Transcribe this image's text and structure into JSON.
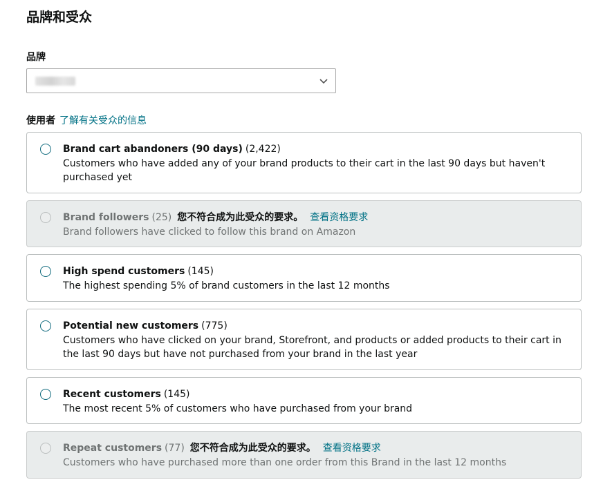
{
  "page": {
    "section_title": "品牌和受众",
    "brand_label": "品牌",
    "usage_label": "使用者",
    "usage_link": "了解有关受众的信息"
  },
  "audiences": [
    {
      "name": "Brand cart abandoners (90 days)",
      "count": "(2,422)",
      "description": "Customers who have added any of your brand products to their cart in the last 90 days but haven't purchased yet",
      "disabled": false
    },
    {
      "name": "Brand followers",
      "count": "(25)",
      "warning": "您不符合成为此受众的要求。",
      "requirements_link": "查看资格要求",
      "description": "Brand followers have clicked to follow this brand on Amazon",
      "disabled": true
    },
    {
      "name": "High spend customers",
      "count": "(145)",
      "description": "The highest spending 5% of brand customers in the last 12 months",
      "disabled": false
    },
    {
      "name": "Potential new customers",
      "count": "(775)",
      "description": "Customers who have clicked on your brand, Storefront, and products or added products to their cart in the last 90 days but have not purchased from your brand in the last year",
      "disabled": false
    },
    {
      "name": "Recent customers",
      "count": "(145)",
      "description": "The most recent 5% of customers who have purchased from your brand",
      "disabled": false
    },
    {
      "name": "Repeat customers",
      "count": "(77)",
      "warning": "您不符合成为此受众的要求。",
      "requirements_link": "查看资格要求",
      "description": "Customers who have purchased more than one order from this Brand in the last 12 months",
      "disabled": true
    }
  ],
  "colors": {
    "link": "#007185",
    "radio_border": "#0f6a7d",
    "disabled_bg": "#e9ecec",
    "card_border": "#bbbfbf"
  },
  "icons": {
    "select_chevron": "chevron-down-icon",
    "radio": "radio-unselected-icon"
  }
}
